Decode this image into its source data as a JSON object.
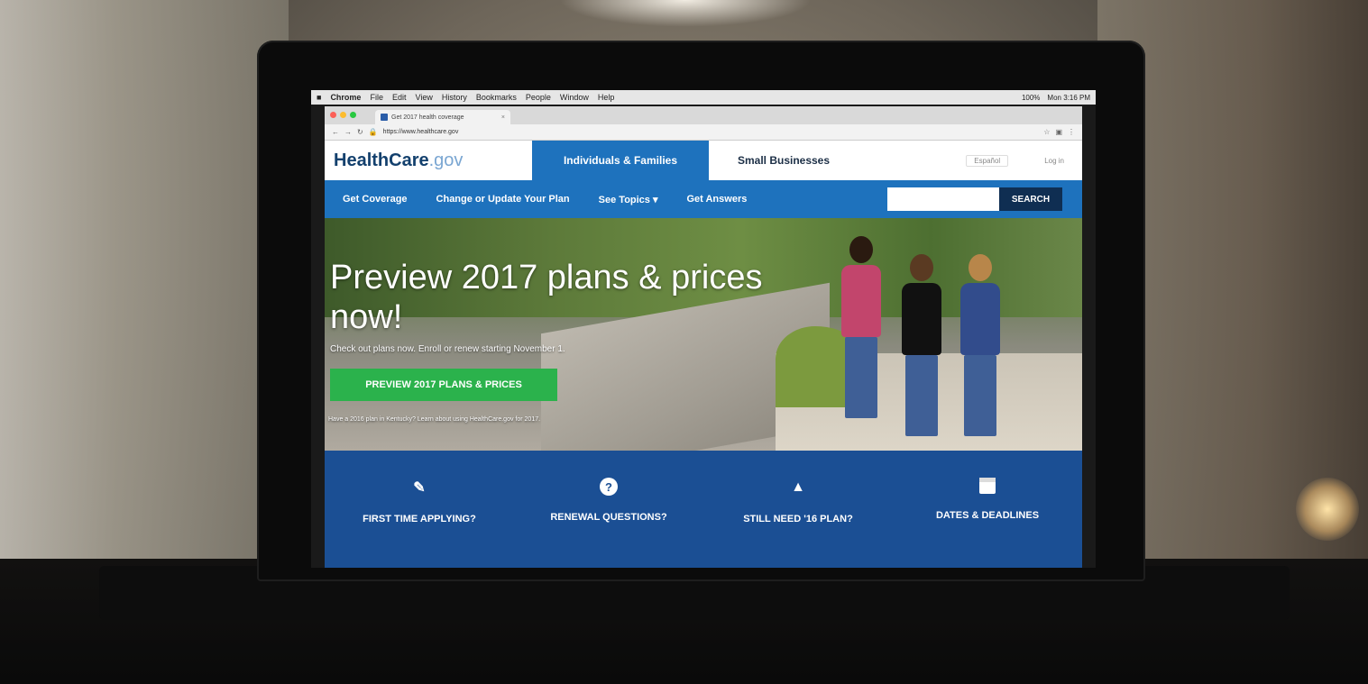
{
  "menubar": {
    "apple": "■",
    "app": "Chrome",
    "items": [
      "File",
      "Edit",
      "View",
      "History",
      "Bookmarks",
      "People",
      "Window",
      "Help"
    ],
    "battery": "100%",
    "clock": "Mon 3:16 PM"
  },
  "browser": {
    "tab_title": "Get 2017 health coverage",
    "url": "https://www.healthcare.gov"
  },
  "site": {
    "logo_main": "HealthCare",
    "logo_suffix": ".gov",
    "tab_individuals": "Individuals & Families",
    "tab_small_business": "Small Businesses",
    "espanol": "Español",
    "login": "Log in"
  },
  "nav": {
    "items": [
      "Get Coverage",
      "Change or Update Your Plan",
      "See Topics ▾",
      "Get Answers"
    ],
    "search_button": "SEARCH"
  },
  "hero": {
    "title": "Preview 2017 plans & prices now!",
    "subtitle": "Check out plans now. Enroll or renew starting November 1.",
    "cta": "PREVIEW 2017 PLANS & PRICES",
    "note": "Have a 2016 plan in Kentucky? Learn about using HealthCare.gov for 2017."
  },
  "quick_links": [
    {
      "icon": "edit-icon",
      "glyph": "✎",
      "label": "FIRST TIME APPLYING?"
    },
    {
      "icon": "question-icon",
      "glyph": "?",
      "label": "RENEWAL QUESTIONS?"
    },
    {
      "icon": "road-icon",
      "glyph": "▲",
      "label": "STILL NEED '16 PLAN?"
    },
    {
      "icon": "calendar-icon",
      "glyph": "",
      "label": "DATES & DEADLINES"
    }
  ],
  "colors": {
    "brand_blue": "#1e72bd",
    "dark_navy": "#0f2e52",
    "cta_green": "#2bb24c",
    "quick_bg": "#1b4f94"
  }
}
